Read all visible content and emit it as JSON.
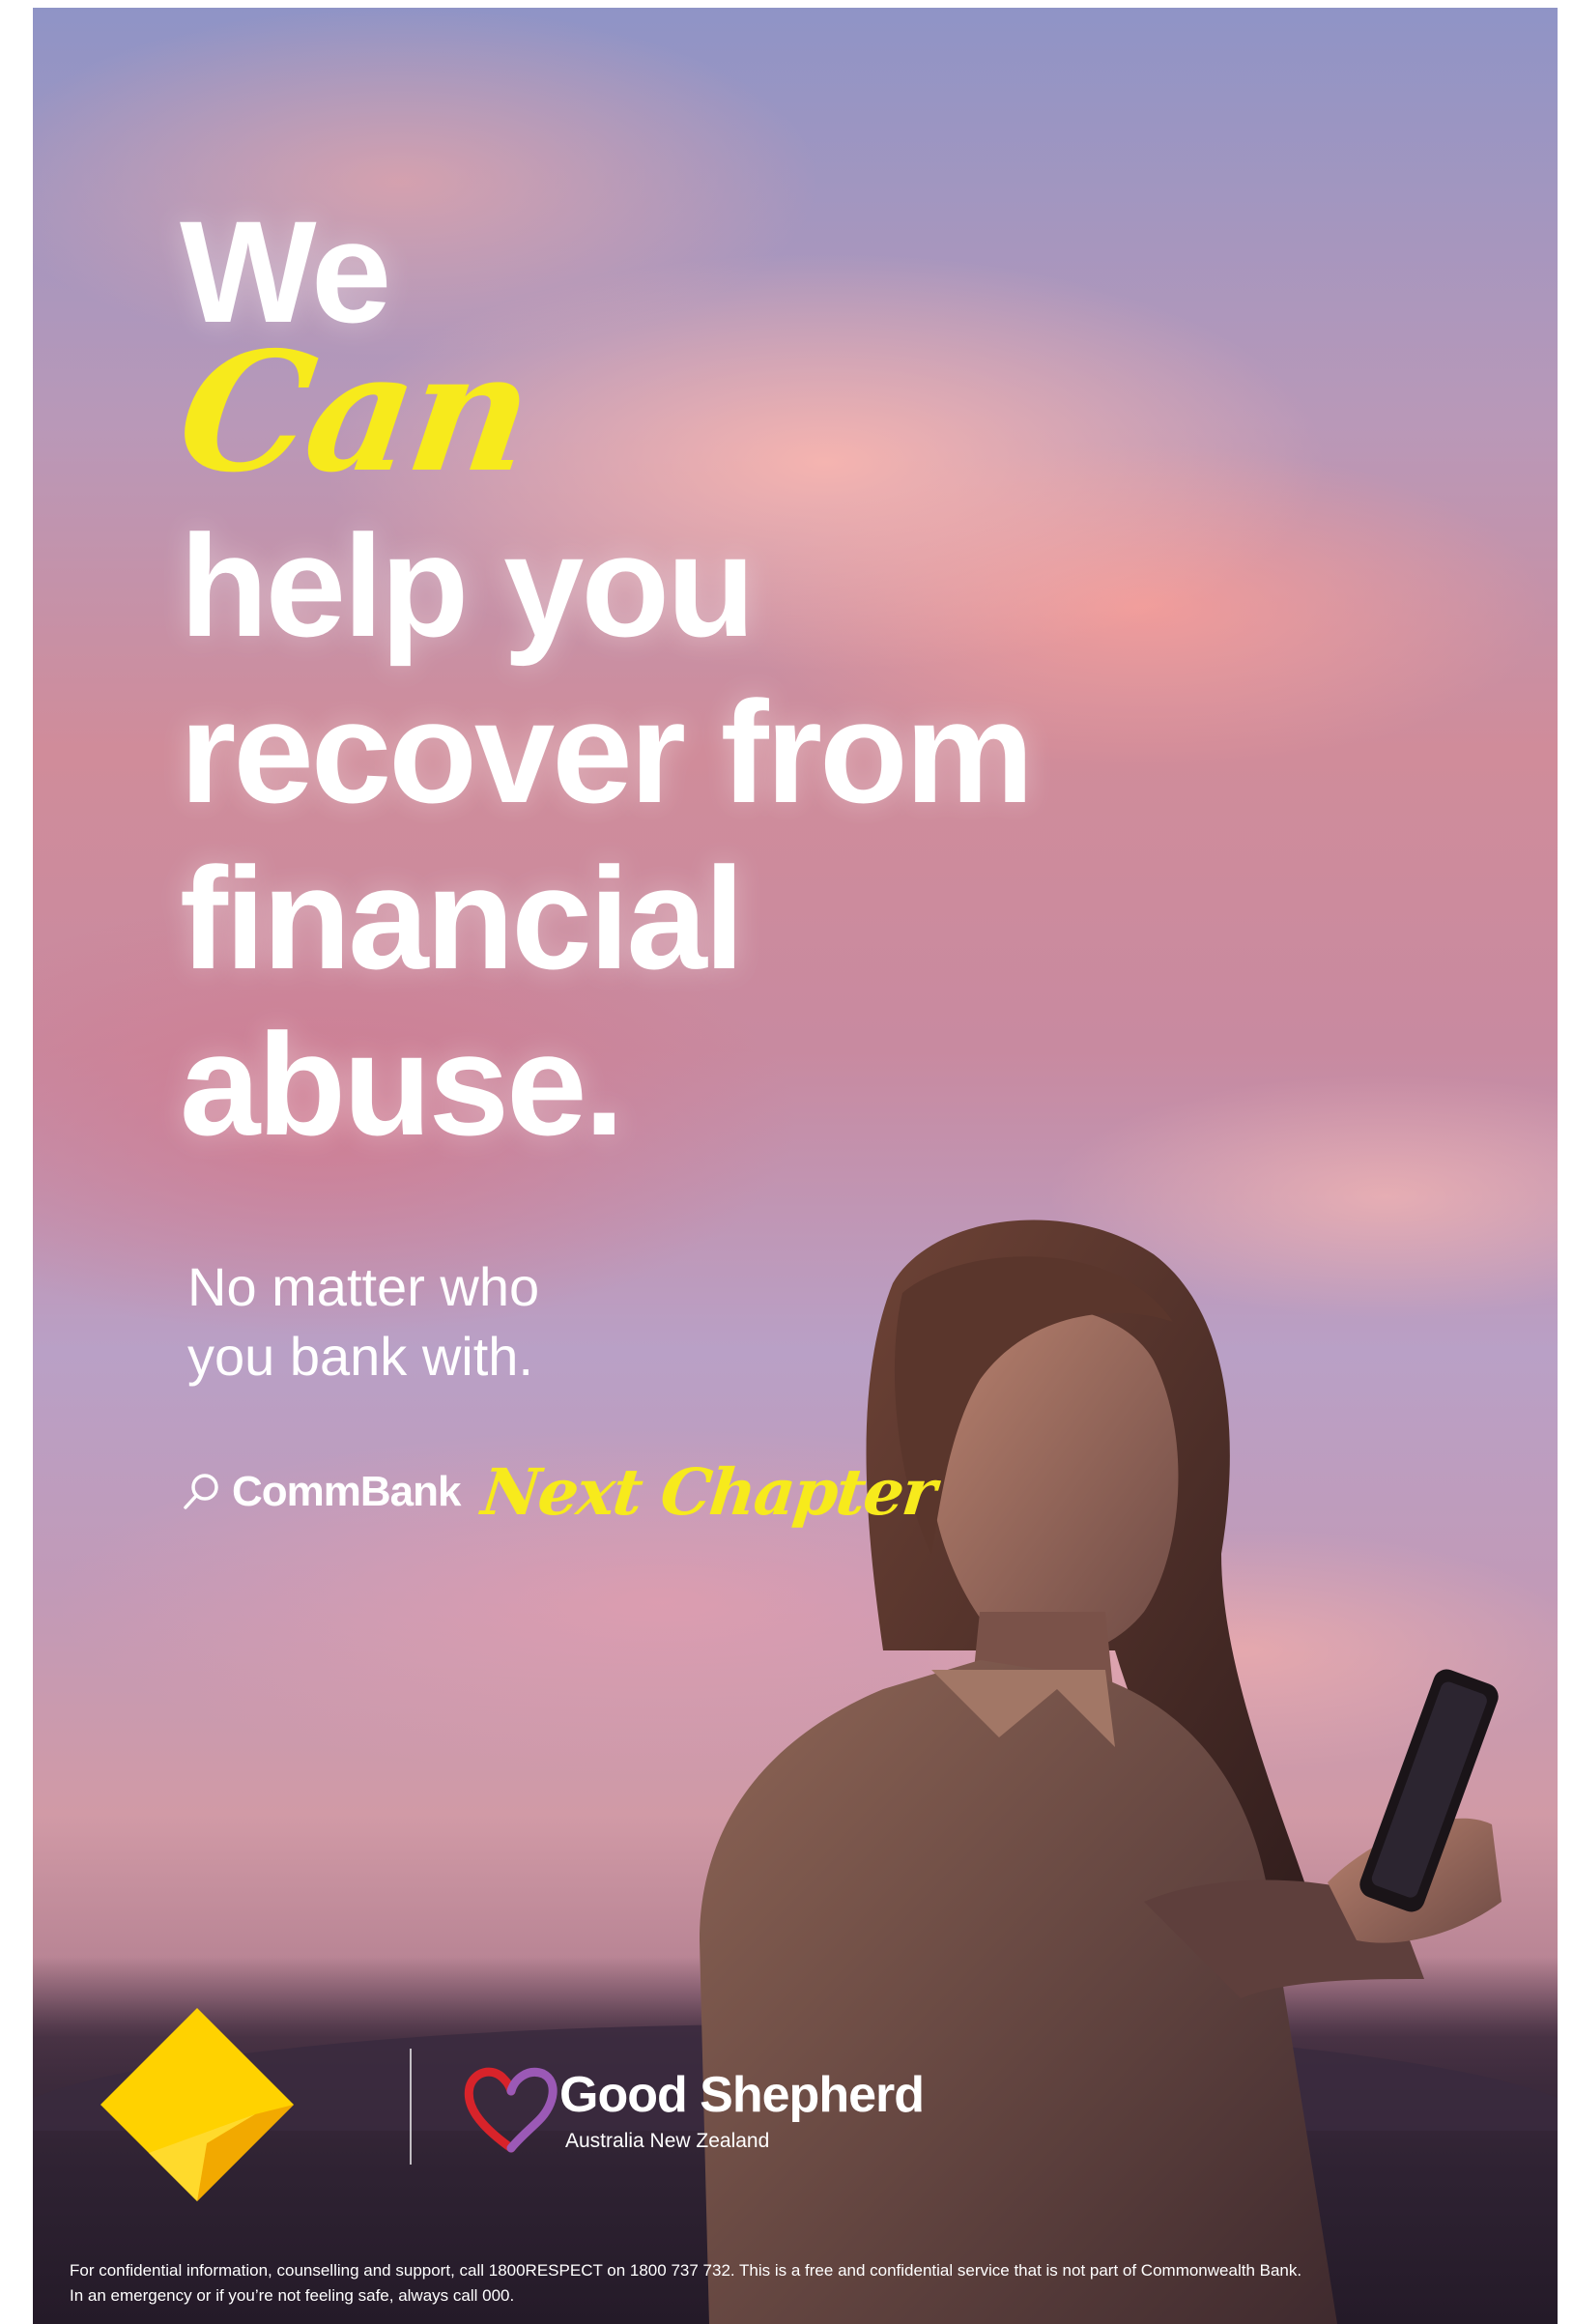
{
  "headline": {
    "line1": "We",
    "script_word": "Can",
    "line2": "help you",
    "line3": "recover from",
    "line4": "financial",
    "line5": "abuse."
  },
  "subheadline": {
    "line1": "No matter who",
    "line2": "you bank with."
  },
  "brand": {
    "name": "CommBank",
    "program": "Next Chapter",
    "icon": "search-icon"
  },
  "partner": {
    "name": "Good Shepherd",
    "subtitle": "Australia New Zealand",
    "icon": "heart-logo-icon"
  },
  "bank_logo": {
    "icon": "commonwealth-bank-diamond-icon"
  },
  "footer": {
    "line1": "For confidential information, counselling and support, call 1800RESPECT on 1800 737 732. This is a free and confidential service that is not part of Commonwealth Bank.",
    "line2": "In an emergency or if you’re not feeling safe, always call 000."
  },
  "colors": {
    "accent_yellow": "#f7ea1c",
    "text_white": "#ffffff"
  }
}
